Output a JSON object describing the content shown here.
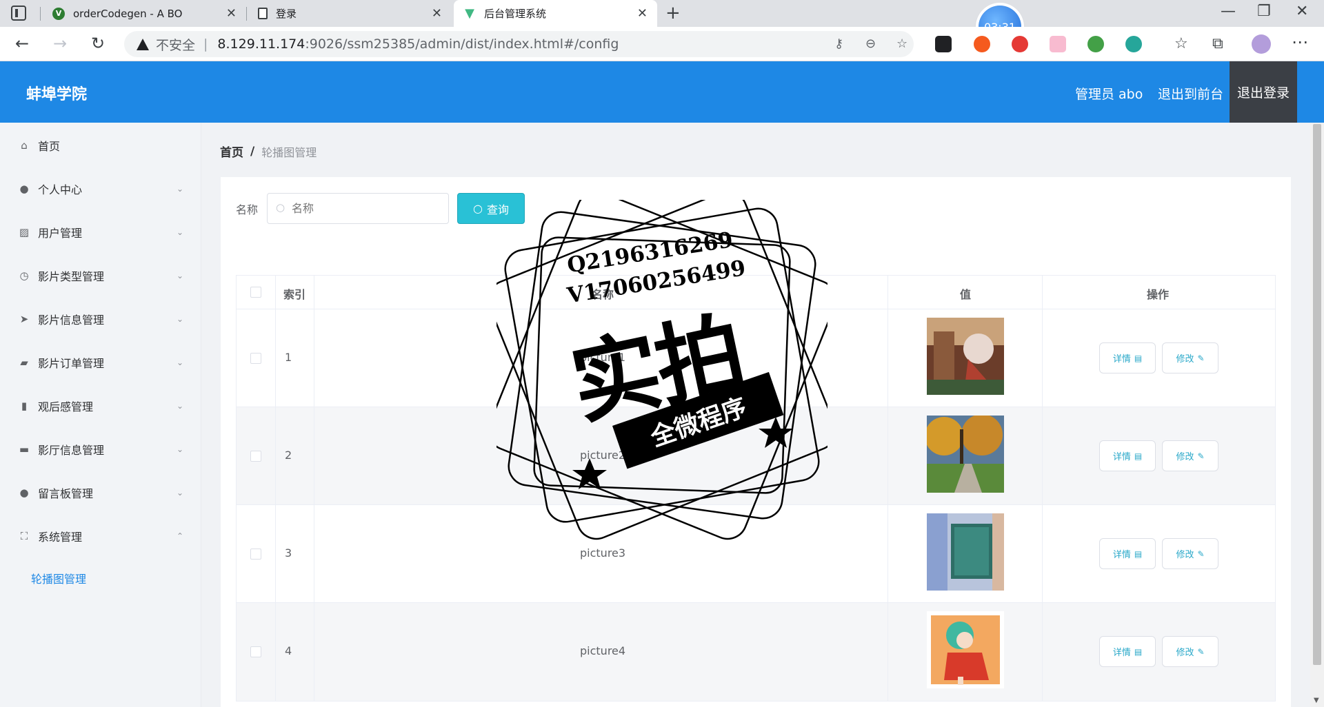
{
  "browser": {
    "tabs": [
      {
        "title": "orderCodegen - A BO",
        "active": false
      },
      {
        "title": "登录",
        "active": false
      },
      {
        "title": "后台管理系统",
        "active": true
      }
    ],
    "timer": "03:31",
    "address": {
      "security": "不安全",
      "host": "8.129.11.174",
      "path": ":9026/ssm25385/admin/dist/index.html#/config"
    }
  },
  "header": {
    "brand": "蚌埠学院",
    "user": "管理员 abo",
    "to_front": "退出到前台",
    "logout": "退出登录",
    "bg_color": "#1e88e5"
  },
  "sidebar": {
    "items": [
      {
        "label": "首页",
        "icon": "home-icon"
      },
      {
        "label": "个人中心",
        "icon": "user-icon"
      },
      {
        "label": "用户管理",
        "icon": "chart-icon"
      },
      {
        "label": "影片类型管理",
        "icon": "clock-icon"
      },
      {
        "label": "影片信息管理",
        "icon": "send-icon"
      },
      {
        "label": "影片订单管理",
        "icon": "briefcase-icon"
      },
      {
        "label": "观后感管理",
        "icon": "bar-chart-icon"
      },
      {
        "label": "影厅信息管理",
        "icon": "message-icon"
      },
      {
        "label": "留言板管理",
        "icon": "bulb-icon"
      },
      {
        "label": "系统管理",
        "icon": "fullscreen-icon"
      }
    ],
    "submenu_active": "轮播图管理"
  },
  "breadcrumb": {
    "home": "首页",
    "separator": "/",
    "current": "轮播图管理"
  },
  "search": {
    "label": "名称",
    "placeholder": "名称",
    "button": "查询"
  },
  "table": {
    "headers": {
      "index": "索引",
      "name": "名称",
      "value": "值",
      "actions": "操作"
    },
    "rows": [
      {
        "index": "1",
        "name": "picture1"
      },
      {
        "index": "2",
        "name": "picture2"
      },
      {
        "index": "3",
        "name": "picture3"
      },
      {
        "index": "4",
        "name": "picture4"
      }
    ],
    "detail_label": "详情",
    "edit_label": "修改"
  },
  "watermark": {
    "line1": "Q2196316269",
    "line2": "V17060256499",
    "big": "实拍",
    "banner": "全微程序"
  }
}
